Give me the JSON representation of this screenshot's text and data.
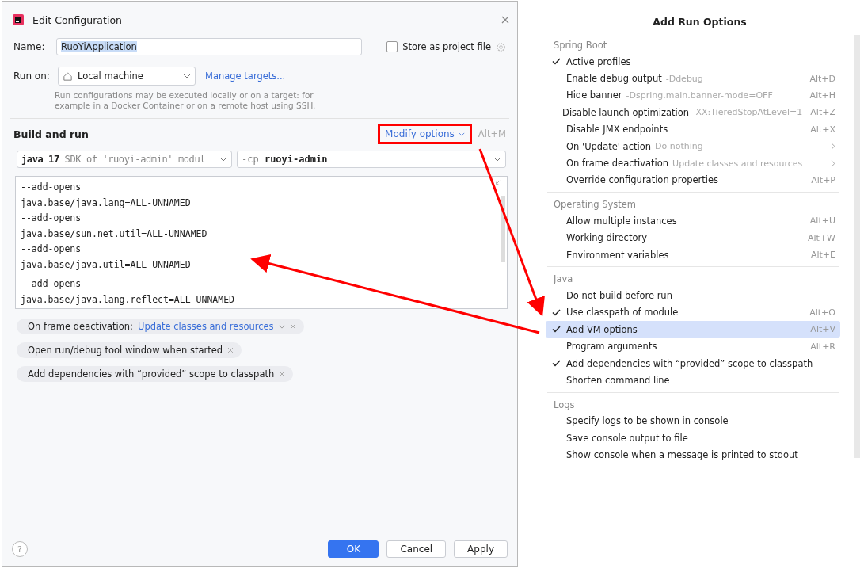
{
  "dialog": {
    "title": "Edit Configuration",
    "name_label": "Name:",
    "name_value": "RuoYiApplication",
    "store_checkbox": {
      "label": "Store as project file",
      "checked": false
    },
    "run_on_label": "Run on:",
    "run_on_value": "Local machine",
    "manage_link": "Manage targets...",
    "hint": "Run configurations may be executed locally or on a target: for example in a Docker Container or on a remote host using SSH.",
    "section": "Build and run",
    "modify_button": "Modify options",
    "modify_shortcut": "Alt+M",
    "jdk": {
      "main": "java 17",
      "rest": "SDK of 'ruoyi-admin' modul"
    },
    "classpath": {
      "flag": "-cp",
      "value": "ruoyi-admin"
    },
    "vm_options": [
      "--add-opens",
      "java.base/java.lang=ALL-UNNAMED",
      "--add-opens",
      "java.base/sun.net.util=ALL-UNNAMED",
      "--add-opens",
      "java.base/java.util=ALL-UNNAMED",
      "--add-opens",
      "java.base/java.lang.reflect=ALL-UNNAMED"
    ],
    "chips": [
      {
        "label": "On frame deactivation:",
        "value": "Update classes and resources"
      },
      {
        "label": "Open run/debug tool window when started"
      },
      {
        "label": "Add dependencies with “provided” scope to classpath"
      }
    ],
    "help": "?",
    "buttons": [
      {
        "label": "OK",
        "kind": "primary"
      },
      {
        "label": "Cancel",
        "kind": "normal"
      },
      {
        "label": "Apply",
        "kind": "normal"
      }
    ]
  },
  "popup": {
    "title": "Add Run Options",
    "groups": [
      {
        "name": "Spring Boot",
        "items": [
          {
            "label": "Active profiles",
            "checked": true,
            "selected": false
          },
          {
            "label": "Enable debug output",
            "hint": "-Ddebug",
            "shortcut": "Alt+D",
            "checked": false,
            "selected": false
          },
          {
            "label": "Hide banner",
            "hint": "-Dspring.main.banner-mode=OFF",
            "shortcut": "Alt+H",
            "checked": false,
            "selected": false
          },
          {
            "label": "Disable launch optimization",
            "hint": "-XX:TieredStopAtLevel=1",
            "shortcut": "Alt+Z",
            "checked": false,
            "selected": false
          },
          {
            "label": "Disable JMX endpoints",
            "shortcut": "Alt+X",
            "checked": false,
            "selected": false
          },
          {
            "label": "On 'Update' action",
            "hint": "Do nothing",
            "submenu": true,
            "checked": false,
            "selected": false
          },
          {
            "label": "On frame deactivation",
            "hint": "Update classes and resources",
            "submenu": true,
            "checked": false,
            "selected": false
          },
          {
            "label": "Override configuration properties",
            "shortcut": "Alt+P",
            "checked": false,
            "selected": false
          }
        ]
      },
      {
        "name": "Operating System",
        "items": [
          {
            "label": "Allow multiple instances",
            "shortcut": "Alt+U",
            "checked": false,
            "selected": false
          },
          {
            "label": "Working directory",
            "shortcut": "Alt+W",
            "checked": false,
            "selected": false
          },
          {
            "label": "Environment variables",
            "shortcut": "Alt+E",
            "checked": false,
            "selected": false
          }
        ]
      },
      {
        "name": "Java",
        "items": [
          {
            "label": "Do not build before run",
            "checked": false,
            "selected": false
          },
          {
            "label": "Use classpath of module",
            "shortcut": "Alt+O",
            "checked": true,
            "selected": false
          },
          {
            "label": "Add VM options",
            "shortcut": "Alt+V",
            "checked": true,
            "selected": true
          },
          {
            "label": "Program arguments",
            "shortcut": "Alt+R",
            "checked": false,
            "selected": false
          },
          {
            "label": "Add dependencies with “provided” scope to classpath",
            "checked": true,
            "selected": false
          },
          {
            "label": "Shorten command line",
            "checked": false,
            "selected": false
          }
        ]
      },
      {
        "name": "Logs",
        "items": [
          {
            "label": "Specify logs to be shown in console",
            "checked": false,
            "selected": false
          },
          {
            "label": "Save console output to file",
            "checked": false,
            "selected": false
          },
          {
            "label": "Show console when a message is printed to stdout",
            "checked": false,
            "selected": false
          }
        ]
      }
    ]
  }
}
